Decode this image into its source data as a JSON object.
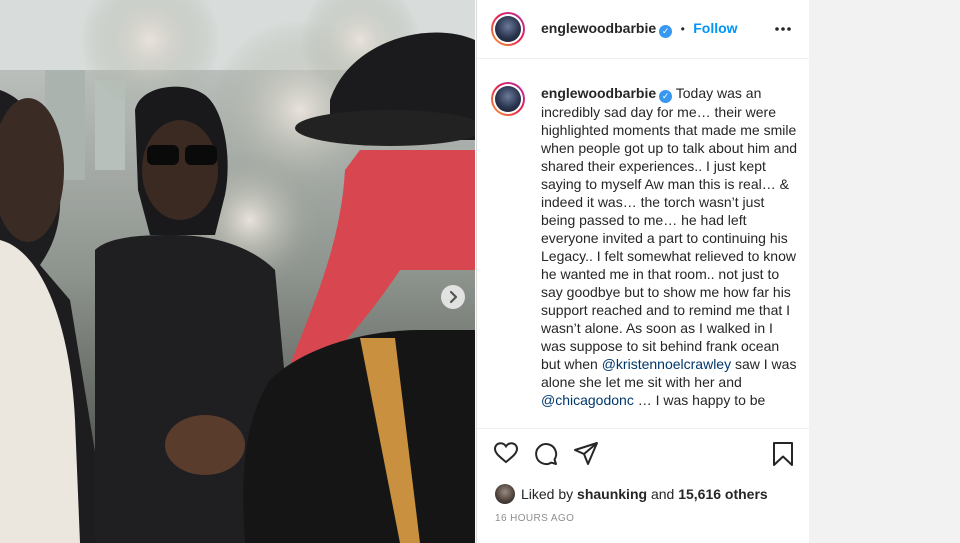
{
  "post": {
    "username": "englewoodbarbie",
    "verified_mark": "✓",
    "separator": "•",
    "follow_label": "Follow",
    "more_icon": "more-options-icon"
  },
  "caption": {
    "username": "englewoodbarbie",
    "part1": "Today was an incredibly sad day for me… their were highlighted moments that made me smile when people got up to talk about him and shared their experiences.. I just kept saying to myself Aw man this is real… & indeed it was… the torch wasn’t just being passed to me… he had left everyone invited a part to continuing his Legacy.. I felt somewhat relieved to know he wanted me in that room.. not just to say goodbye but to show me how far his support reached and to remind me that I wasn’t alone. As soon as I walked in I was suppose to sit behind frank ocean but when ",
    "mention1": "@kristennoelcrawley",
    "part2": " saw I was alone she let me sit with her and ",
    "mention2": "@chicagodonc",
    "part3": " … I was happy to be"
  },
  "actions": {
    "icons": [
      "heart-icon",
      "comment-icon",
      "share-icon",
      "bookmark-icon"
    ]
  },
  "likes": {
    "prefix": "Liked by",
    "user": "shaunking",
    "middle": "and",
    "others": "15,616 others"
  },
  "timestamp": "16 HOURS AGO",
  "colors": {
    "link_blue": "#0095f6",
    "mention_blue": "#00376b",
    "verified_blue": "#3897f0",
    "text": "#262626",
    "muted": "#8e8e8e"
  }
}
